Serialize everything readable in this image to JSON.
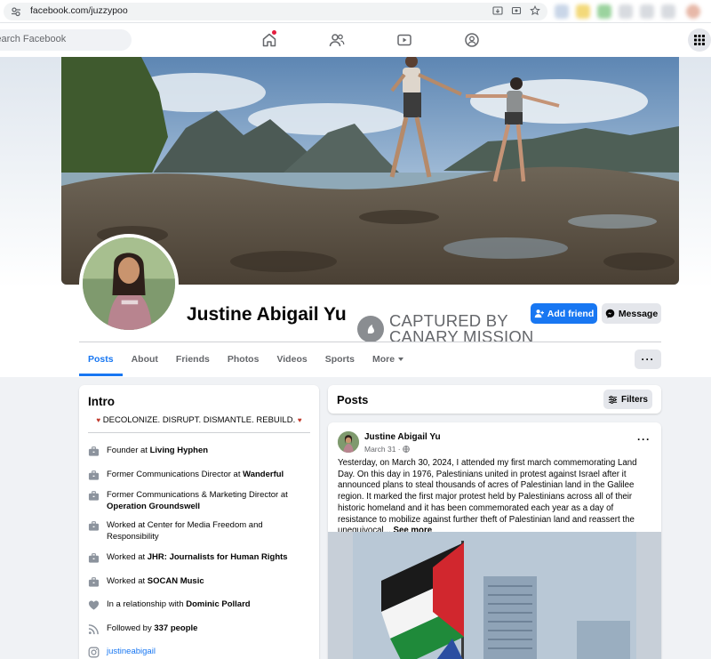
{
  "browser": {
    "url": "facebook.com/juzzypoo"
  },
  "nav": {
    "search_placeholder": "Search Facebook"
  },
  "profile": {
    "name": "Justine Abigail Yu",
    "add_friend_label": "Add friend",
    "message_label": "Message"
  },
  "watermark": {
    "line1": "CAPTURED BY",
    "line2": "CANARY MISSION"
  },
  "tabs": {
    "items": [
      "Posts",
      "About",
      "Friends",
      "Photos",
      "Videos",
      "Sports",
      "More"
    ]
  },
  "intro": {
    "title": "Intro",
    "bio": "DECOLONIZE. DISRUPT. DISMANTLE. REBUILD.",
    "items": [
      {
        "prefix": "Founder at ",
        "bold": "Living Hyphen",
        "icon": "briefcase-icon"
      },
      {
        "prefix": "Former Communications Director at ",
        "bold": "Wanderful",
        "icon": "briefcase-icon"
      },
      {
        "prefix": "Former Communications & Marketing Director at ",
        "bold": "Operation Groundswell",
        "icon": "briefcase-icon"
      },
      {
        "prefix": "Worked at Center for Media Freedom and Responsibility",
        "bold": "",
        "icon": "briefcase-icon"
      },
      {
        "prefix": "Worked at ",
        "bold": "JHR: Journalists for Human Rights",
        "icon": "briefcase-icon"
      },
      {
        "prefix": "Worked at ",
        "bold": "SOCAN Music",
        "icon": "briefcase-icon"
      },
      {
        "prefix": "In a relationship with ",
        "bold": "Dominic Pollard",
        "icon": "heart-icon"
      },
      {
        "prefix": "Followed by ",
        "bold": "337 people",
        "icon": "rss-icon"
      },
      {
        "prefix": "",
        "bold": "",
        "link": "justineabigail",
        "icon": "instagram-icon"
      }
    ]
  },
  "posts": {
    "title": "Posts",
    "filters_label": "Filters",
    "post": {
      "author": "Justine Abigail Yu",
      "date": "March 31 ·",
      "text": "Yesterday, on March 30, 2024, I attended my first march commemorating Land Day. On this day in 1976, Palestinians united in protest against Israel after it announced plans to steal thousands of acres of Palestinian land in the Galilee region. It marked the first major protest held by Palestinians across all of their historic homeland and it has been commemorated each year as a day of resistance to mobilize against further theft of Palestinian land and reassert the unequivocal...",
      "see_more": "See more"
    }
  },
  "colors": {
    "accent": "#1877f2",
    "background": "#f0f2f5",
    "secondary_text": "#65676b"
  }
}
